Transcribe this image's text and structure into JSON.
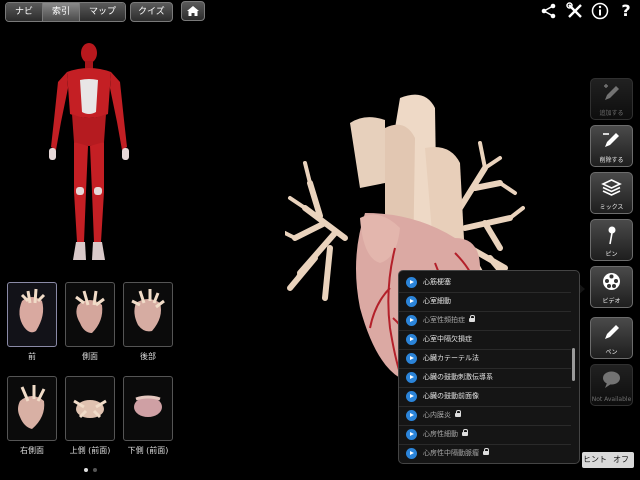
{
  "topbar": {
    "tabs": [
      {
        "label": "ナビ",
        "active": false
      },
      {
        "label": "索引",
        "active": true
      },
      {
        "label": "マップ",
        "active": false
      }
    ],
    "quiz_label": "クイズ",
    "icons": [
      "home-icon",
      "share-icon",
      "tools-icon",
      "info-icon",
      "help-icon"
    ],
    "help_label": "?"
  },
  "views": [
    {
      "label": "前",
      "selected": true
    },
    {
      "label": "側面",
      "selected": false
    },
    {
      "label": "後部",
      "selected": false
    },
    {
      "label": "右側面",
      "selected": false
    },
    {
      "label": "上側 (前面)",
      "selected": false
    },
    {
      "label": "下側 (前面)",
      "selected": false
    }
  ],
  "pager": {
    "pages": 2,
    "current": 1
  },
  "tools": [
    {
      "label": "追加する",
      "icon": "pencil-add-icon",
      "enabled": false
    },
    {
      "label": "削除する",
      "icon": "pencil-remove-icon",
      "enabled": true
    },
    {
      "label": "ミックス",
      "icon": "layers-icon",
      "enabled": true
    },
    {
      "label": "ピン",
      "icon": "pin-icon",
      "enabled": true
    },
    {
      "label": "ビデオ",
      "icon": "film-reel-icon",
      "enabled": true
    },
    {
      "label": "ペン",
      "icon": "pen-icon",
      "enabled": true
    },
    {
      "label": "Not Available",
      "icon": "speech-bubble-icon",
      "enabled": false
    }
  ],
  "video_list": [
    {
      "title": "心筋梗塞",
      "locked": false
    },
    {
      "title": "心室細動",
      "locked": false
    },
    {
      "title": "心室性頻拍症",
      "locked": true
    },
    {
      "title": "心室中隔欠損症",
      "locked": false
    },
    {
      "title": "心臓カテーテル法",
      "locked": false
    },
    {
      "title": "心臓の鼓動刺激伝導系",
      "locked": false
    },
    {
      "title": "心臓の鼓動前面像",
      "locked": false
    },
    {
      "title": "心内膜炎",
      "locked": true
    },
    {
      "title": "心房性細動",
      "locked": true
    },
    {
      "title": "心房性中隔動脈瘤",
      "locked": true
    }
  ],
  "hint": {
    "label": "ヒント",
    "state": "オフ"
  },
  "colors": {
    "accent": "#2b84d9",
    "background": "#000000",
    "muscle": "#c21f24",
    "heart": "#e3bfb3"
  }
}
